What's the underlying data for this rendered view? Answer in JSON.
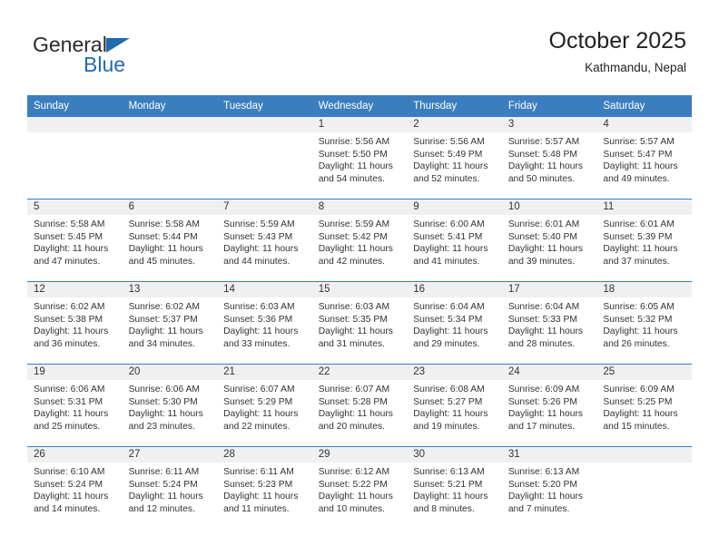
{
  "brand": {
    "name_part1": "General",
    "name_part2": "Blue",
    "triangle_icon": "triangle-icon",
    "accent_color": "#1f6cb0"
  },
  "header": {
    "title": "October 2025",
    "subtitle": "Kathmandu, Nepal"
  },
  "calendar": {
    "header_color": "#3b7ec0",
    "daynum_band_color": "#f0f0f0",
    "weekday_headers": [
      "Sunday",
      "Monday",
      "Tuesday",
      "Wednesday",
      "Thursday",
      "Friday",
      "Saturday"
    ],
    "labels": {
      "sunrise": "Sunrise:",
      "sunset": "Sunset:",
      "daylight": "Daylight:"
    },
    "weeks": [
      [
        {
          "day": "",
          "blank": true
        },
        {
          "day": "",
          "blank": true
        },
        {
          "day": "",
          "blank": true
        },
        {
          "day": "1",
          "sunrise": "Sunrise: 5:56 AM",
          "sunset": "Sunset: 5:50 PM",
          "daylight": "Daylight: 11 hours and 54 minutes."
        },
        {
          "day": "2",
          "sunrise": "Sunrise: 5:56 AM",
          "sunset": "Sunset: 5:49 PM",
          "daylight": "Daylight: 11 hours and 52 minutes."
        },
        {
          "day": "3",
          "sunrise": "Sunrise: 5:57 AM",
          "sunset": "Sunset: 5:48 PM",
          "daylight": "Daylight: 11 hours and 50 minutes."
        },
        {
          "day": "4",
          "sunrise": "Sunrise: 5:57 AM",
          "sunset": "Sunset: 5:47 PM",
          "daylight": "Daylight: 11 hours and 49 minutes."
        }
      ],
      [
        {
          "day": "5",
          "sunrise": "Sunrise: 5:58 AM",
          "sunset": "Sunset: 5:45 PM",
          "daylight": "Daylight: 11 hours and 47 minutes."
        },
        {
          "day": "6",
          "sunrise": "Sunrise: 5:58 AM",
          "sunset": "Sunset: 5:44 PM",
          "daylight": "Daylight: 11 hours and 45 minutes."
        },
        {
          "day": "7",
          "sunrise": "Sunrise: 5:59 AM",
          "sunset": "Sunset: 5:43 PM",
          "daylight": "Daylight: 11 hours and 44 minutes."
        },
        {
          "day": "8",
          "sunrise": "Sunrise: 5:59 AM",
          "sunset": "Sunset: 5:42 PM",
          "daylight": "Daylight: 11 hours and 42 minutes."
        },
        {
          "day": "9",
          "sunrise": "Sunrise: 6:00 AM",
          "sunset": "Sunset: 5:41 PM",
          "daylight": "Daylight: 11 hours and 41 minutes."
        },
        {
          "day": "10",
          "sunrise": "Sunrise: 6:01 AM",
          "sunset": "Sunset: 5:40 PM",
          "daylight": "Daylight: 11 hours and 39 minutes."
        },
        {
          "day": "11",
          "sunrise": "Sunrise: 6:01 AM",
          "sunset": "Sunset: 5:39 PM",
          "daylight": "Daylight: 11 hours and 37 minutes."
        }
      ],
      [
        {
          "day": "12",
          "sunrise": "Sunrise: 6:02 AM",
          "sunset": "Sunset: 5:38 PM",
          "daylight": "Daylight: 11 hours and 36 minutes."
        },
        {
          "day": "13",
          "sunrise": "Sunrise: 6:02 AM",
          "sunset": "Sunset: 5:37 PM",
          "daylight": "Daylight: 11 hours and 34 minutes."
        },
        {
          "day": "14",
          "sunrise": "Sunrise: 6:03 AM",
          "sunset": "Sunset: 5:36 PM",
          "daylight": "Daylight: 11 hours and 33 minutes."
        },
        {
          "day": "15",
          "sunrise": "Sunrise: 6:03 AM",
          "sunset": "Sunset: 5:35 PM",
          "daylight": "Daylight: 11 hours and 31 minutes."
        },
        {
          "day": "16",
          "sunrise": "Sunrise: 6:04 AM",
          "sunset": "Sunset: 5:34 PM",
          "daylight": "Daylight: 11 hours and 29 minutes."
        },
        {
          "day": "17",
          "sunrise": "Sunrise: 6:04 AM",
          "sunset": "Sunset: 5:33 PM",
          "daylight": "Daylight: 11 hours and 28 minutes."
        },
        {
          "day": "18",
          "sunrise": "Sunrise: 6:05 AM",
          "sunset": "Sunset: 5:32 PM",
          "daylight": "Daylight: 11 hours and 26 minutes."
        }
      ],
      [
        {
          "day": "19",
          "sunrise": "Sunrise: 6:06 AM",
          "sunset": "Sunset: 5:31 PM",
          "daylight": "Daylight: 11 hours and 25 minutes."
        },
        {
          "day": "20",
          "sunrise": "Sunrise: 6:06 AM",
          "sunset": "Sunset: 5:30 PM",
          "daylight": "Daylight: 11 hours and 23 minutes."
        },
        {
          "day": "21",
          "sunrise": "Sunrise: 6:07 AM",
          "sunset": "Sunset: 5:29 PM",
          "daylight": "Daylight: 11 hours and 22 minutes."
        },
        {
          "day": "22",
          "sunrise": "Sunrise: 6:07 AM",
          "sunset": "Sunset: 5:28 PM",
          "daylight": "Daylight: 11 hours and 20 minutes."
        },
        {
          "day": "23",
          "sunrise": "Sunrise: 6:08 AM",
          "sunset": "Sunset: 5:27 PM",
          "daylight": "Daylight: 11 hours and 19 minutes."
        },
        {
          "day": "24",
          "sunrise": "Sunrise: 6:09 AM",
          "sunset": "Sunset: 5:26 PM",
          "daylight": "Daylight: 11 hours and 17 minutes."
        },
        {
          "day": "25",
          "sunrise": "Sunrise: 6:09 AM",
          "sunset": "Sunset: 5:25 PM",
          "daylight": "Daylight: 11 hours and 15 minutes."
        }
      ],
      [
        {
          "day": "26",
          "sunrise": "Sunrise: 6:10 AM",
          "sunset": "Sunset: 5:24 PM",
          "daylight": "Daylight: 11 hours and 14 minutes."
        },
        {
          "day": "27",
          "sunrise": "Sunrise: 6:11 AM",
          "sunset": "Sunset: 5:24 PM",
          "daylight": "Daylight: 11 hours and 12 minutes."
        },
        {
          "day": "28",
          "sunrise": "Sunrise: 6:11 AM",
          "sunset": "Sunset: 5:23 PM",
          "daylight": "Daylight: 11 hours and 11 minutes."
        },
        {
          "day": "29",
          "sunrise": "Sunrise: 6:12 AM",
          "sunset": "Sunset: 5:22 PM",
          "daylight": "Daylight: 11 hours and 10 minutes."
        },
        {
          "day": "30",
          "sunrise": "Sunrise: 6:13 AM",
          "sunset": "Sunset: 5:21 PM",
          "daylight": "Daylight: 11 hours and 8 minutes."
        },
        {
          "day": "31",
          "sunrise": "Sunrise: 6:13 AM",
          "sunset": "Sunset: 5:20 PM",
          "daylight": "Daylight: 11 hours and 7 minutes."
        },
        {
          "day": "",
          "blank": true
        }
      ]
    ]
  }
}
